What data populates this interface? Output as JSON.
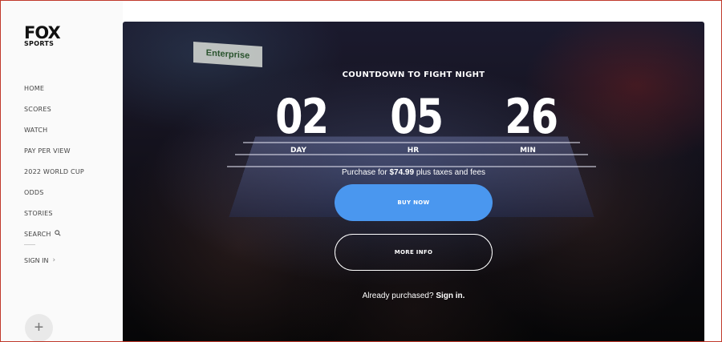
{
  "brand": {
    "line1": "FOX",
    "line2": "SPORTS"
  },
  "sidebar": {
    "items": [
      {
        "label": "HOME"
      },
      {
        "label": "SCORES"
      },
      {
        "label": "WATCH"
      },
      {
        "label": "PAY PER VIEW"
      },
      {
        "label": "2022 WORLD CUP"
      },
      {
        "label": "ODDS"
      },
      {
        "label": "STORIES"
      },
      {
        "label": "SEARCH",
        "icon": "search-icon"
      }
    ],
    "signin": {
      "label": "SIGN IN",
      "icon": "chevron-right-icon"
    },
    "fab": {
      "label": "+",
      "icon": "plus-icon"
    }
  },
  "hero": {
    "banner_text": "Enterprise",
    "title": "COUNTDOWN TO FIGHT NIGHT",
    "countdown": [
      {
        "value": "02",
        "unit": "DAY"
      },
      {
        "value": "05",
        "unit": "HR"
      },
      {
        "value": "26",
        "unit": "MIN"
      }
    ],
    "price_prefix": "Purchase for ",
    "price_amount": "$74.99",
    "price_suffix": " plus taxes and fees",
    "buy_label": "BUY NOW",
    "more_label": "MORE INFO",
    "already_text": "Already purchased? ",
    "signin_link": "Sign in."
  },
  "colors": {
    "accent": "#4a97ef",
    "border": "#c0392b"
  }
}
